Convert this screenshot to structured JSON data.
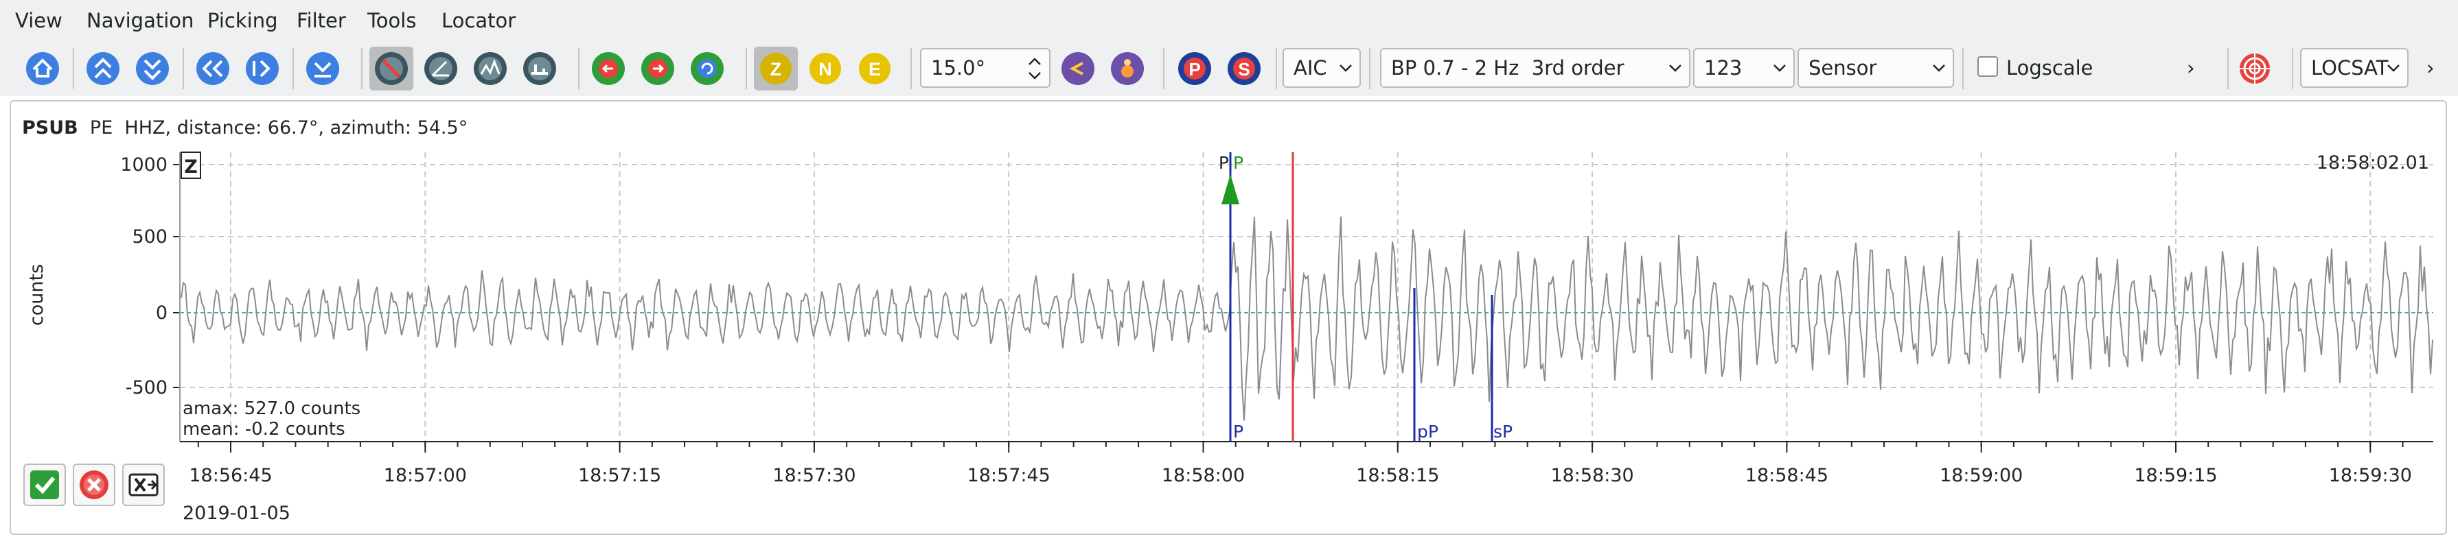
{
  "menu": [
    "View",
    "Navigation",
    "Picking",
    "Filter",
    "Tools",
    "Locator"
  ],
  "toolbar": {
    "icons": [
      "home-icon",
      "scroll-up-icon",
      "scroll-down-icon",
      "scroll-left-icon",
      "scroll-right-icon",
      "align-icon",
      "pick-disable-icon",
      "pick-angle-icon",
      "pick-amplitude-icon",
      "pick-quality-icon",
      "go-prev-icon",
      "go-next-icon",
      "refresh-icon"
    ],
    "components": [
      "Z",
      "N",
      "E"
    ],
    "component_colors": {
      "Z": "#d6b300",
      "N": "#e7c300",
      "E": "#e7c300"
    },
    "angle_value": "15.0°",
    "picker": "AIC",
    "filter": "BP 0.7 - 2 Hz  3rd order",
    "channel": "123",
    "units": "Sensor",
    "logscale_label": "Logscale",
    "logscale_checked": false,
    "more_glyph": "›",
    "locator": "LOCSAT",
    "locator_more_glyph": "›",
    "phase_buttons": [
      "P",
      "S"
    ]
  },
  "trace": {
    "station": "PSUB",
    "header_rest": "PE  HHZ, distance: 66.7°, azimuth: 54.5°",
    "component_label": "Z",
    "time_label": "18:58:02.01",
    "ylabel": "counts",
    "yticks": [
      "1000",
      "500",
      "0",
      "-500"
    ],
    "amax": "amax: 527.0 counts",
    "mean": "mean: -0.2 counts",
    "xticks": [
      "18:56:45",
      "18:57:00",
      "18:57:15",
      "18:57:30",
      "18:57:45",
      "18:58:00",
      "18:58:15",
      "18:58:30",
      "18:58:45",
      "18:59:00",
      "18:59:15",
      "18:59:30"
    ],
    "date": "2019-01-05",
    "picks": {
      "top_black": "P",
      "top_green": "P",
      "predicted": [
        "P",
        "pP",
        "sP"
      ]
    },
    "colors": {
      "pick_green": "#1f9a1f",
      "pick_blue": "#1a2da8",
      "origin_red": "#e23c3c",
      "trace": "#8c8c8c",
      "zero": "#5a9fb8",
      "grid": "#c8c8c8"
    }
  },
  "dialog": {
    "accept_icon": "accept-icon",
    "reject_icon": "reject-icon",
    "close_icon": "close-icon"
  }
}
